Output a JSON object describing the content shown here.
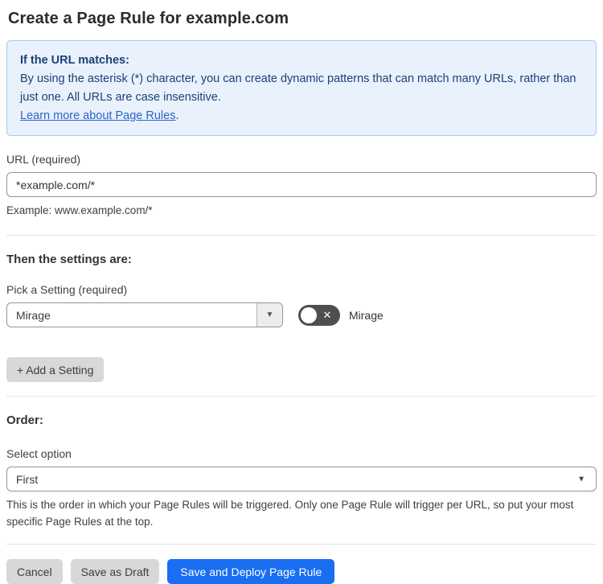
{
  "page": {
    "title": "Create a Page Rule for example.com"
  },
  "info_box": {
    "heading": "If the URL matches:",
    "body": "By using the asterisk (*) character, you can create dynamic patterns that can match many URLs, rather than just one. All URLs are case insensitive.",
    "link_label": "Learn more about Page Rules",
    "link_suffix": "."
  },
  "url_field": {
    "label": "URL (required)",
    "value": "*example.com/*",
    "helper": "Example: www.example.com/*"
  },
  "settings": {
    "heading": "Then the settings are:",
    "picker_label": "Pick a Setting (required)",
    "selected_setting": "Mirage",
    "toggle_state": "off",
    "toggle_label": "Mirage",
    "add_button_label": "+ Add a Setting"
  },
  "order": {
    "heading": "Order:",
    "label": "Select option",
    "selected_option": "First",
    "helper": "This is the order in which your Page Rules will be triggered. Only one Page Rule will trigger per URL, so put your most specific Page Rules at the top."
  },
  "footer": {
    "cancel_label": "Cancel",
    "save_draft_label": "Save as Draft",
    "save_deploy_label": "Save and Deploy Page Rule"
  },
  "icons": {
    "dropdown_arrow": "▼",
    "toggle_off_x": "✕"
  },
  "colors": {
    "info_background": "#e9f2fc",
    "info_border": "#a3c9ee",
    "info_text": "#1d3f78",
    "link_blue": "#2c62cb",
    "primary_button_blue": "#1a6ef2",
    "toggle_off_gray": "#4f4f4f",
    "secondary_button_gray": "#d8d8d8"
  }
}
